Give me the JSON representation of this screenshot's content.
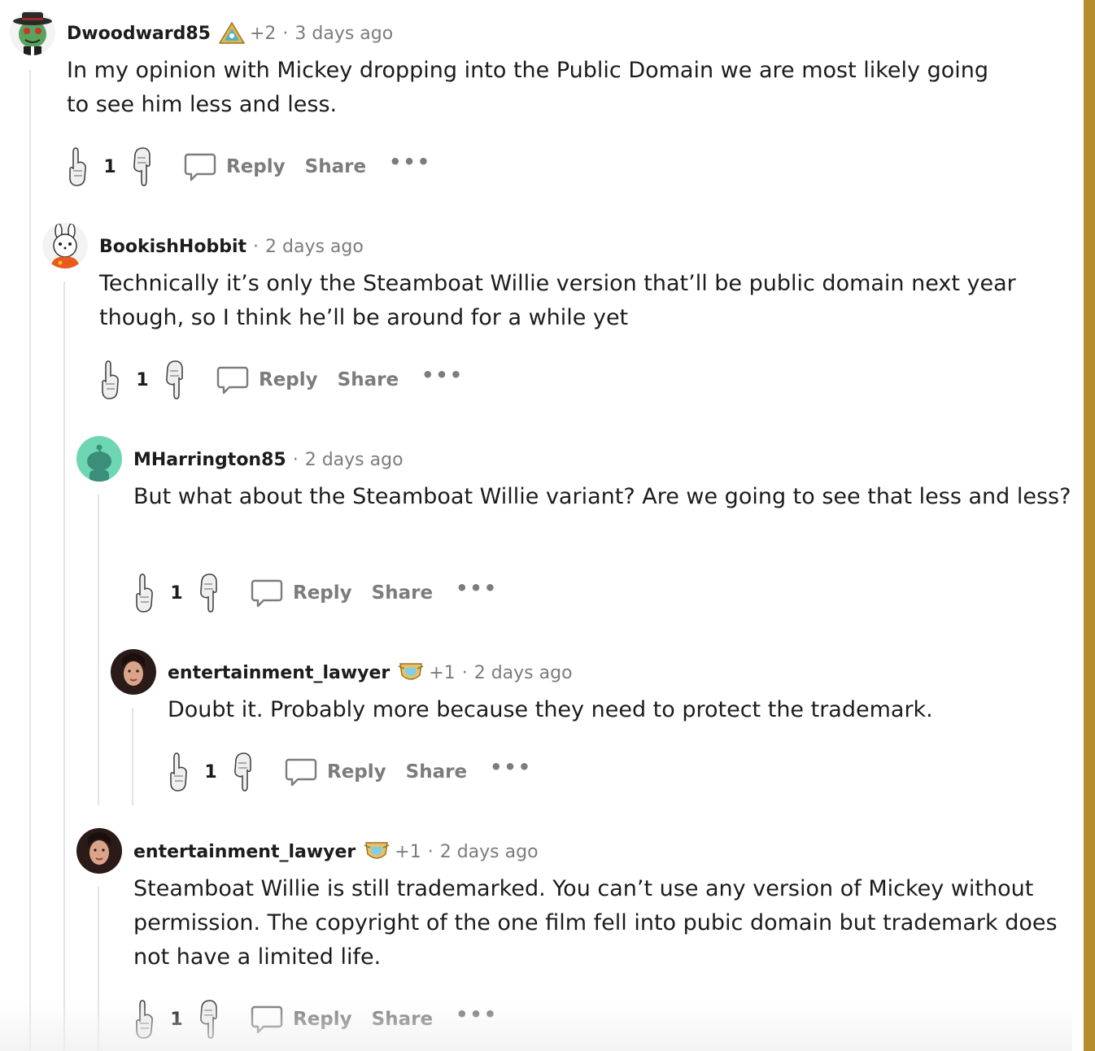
{
  "actions": {
    "reply": "Reply",
    "share": "Share",
    "more": "•••"
  },
  "comments": [
    {
      "username": "Dwoodward85",
      "extra": "+2",
      "separator": "·",
      "time": "3 days ago",
      "body": "In my opinion with Mickey dropping into the Public Domain we are most likely going to see him less and less.",
      "score": "1"
    },
    {
      "username": "BookishHobbit",
      "extra": "",
      "separator": "·",
      "time": "2 days ago",
      "body": "Technically it’s only the Steamboat Willie version that’ll be public domain next year though, so I think he’ll be around for a while yet",
      "score": "1"
    },
    {
      "username": "MHarrington85",
      "extra": "",
      "separator": "·",
      "time": "2 days ago",
      "body": "But what about the Steamboat Willie variant? Are we going to see that less and less?",
      "score": "1"
    },
    {
      "username": "entertainment_lawyer",
      "extra": "+1",
      "separator": "·",
      "time": "2 days ago",
      "body": "Doubt it. Probably more because they need to protect the trademark.",
      "score": "1"
    },
    {
      "username": "entertainment_lawyer",
      "extra": "+1",
      "separator": "·",
      "time": "2 days ago",
      "body": "Steamboat Willie is still trademarked. You can’t use any version of Mickey without permission. The copyright of the one film fell into pubic domain but trademark does not have a limited life.",
      "score": "1"
    }
  ],
  "colors": {
    "accent_bar": "#b48e2e",
    "meta_text": "#7c7c7c",
    "thread_line": "#e3e4e6",
    "text": "#1c1c1c"
  }
}
